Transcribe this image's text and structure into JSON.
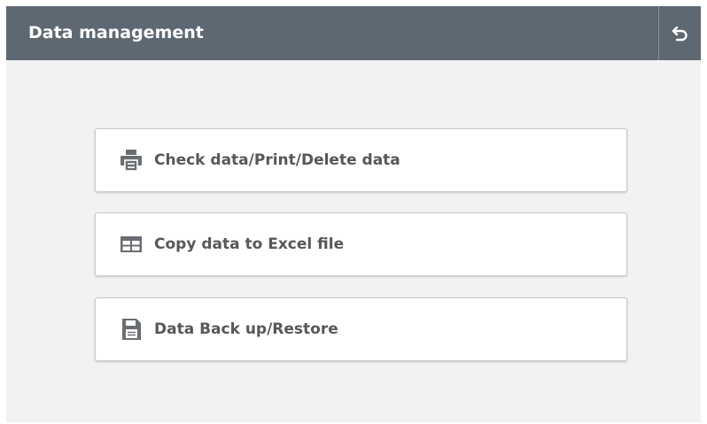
{
  "header": {
    "title": "Data management",
    "back_icon": "undo-arrow-icon"
  },
  "menu": [
    {
      "label": "Check data/Print/Delete data",
      "icon": "printer-icon"
    },
    {
      "label": "Copy data to Excel file",
      "icon": "table-icon"
    },
    {
      "label": "Data Back up/Restore",
      "icon": "save-file-icon"
    }
  ],
  "colors": {
    "header_bg": "#5e6873",
    "page_bg": "#f2f2f2",
    "button_bg": "#ffffff",
    "icon": "#6a6e73",
    "text": "#575757"
  }
}
